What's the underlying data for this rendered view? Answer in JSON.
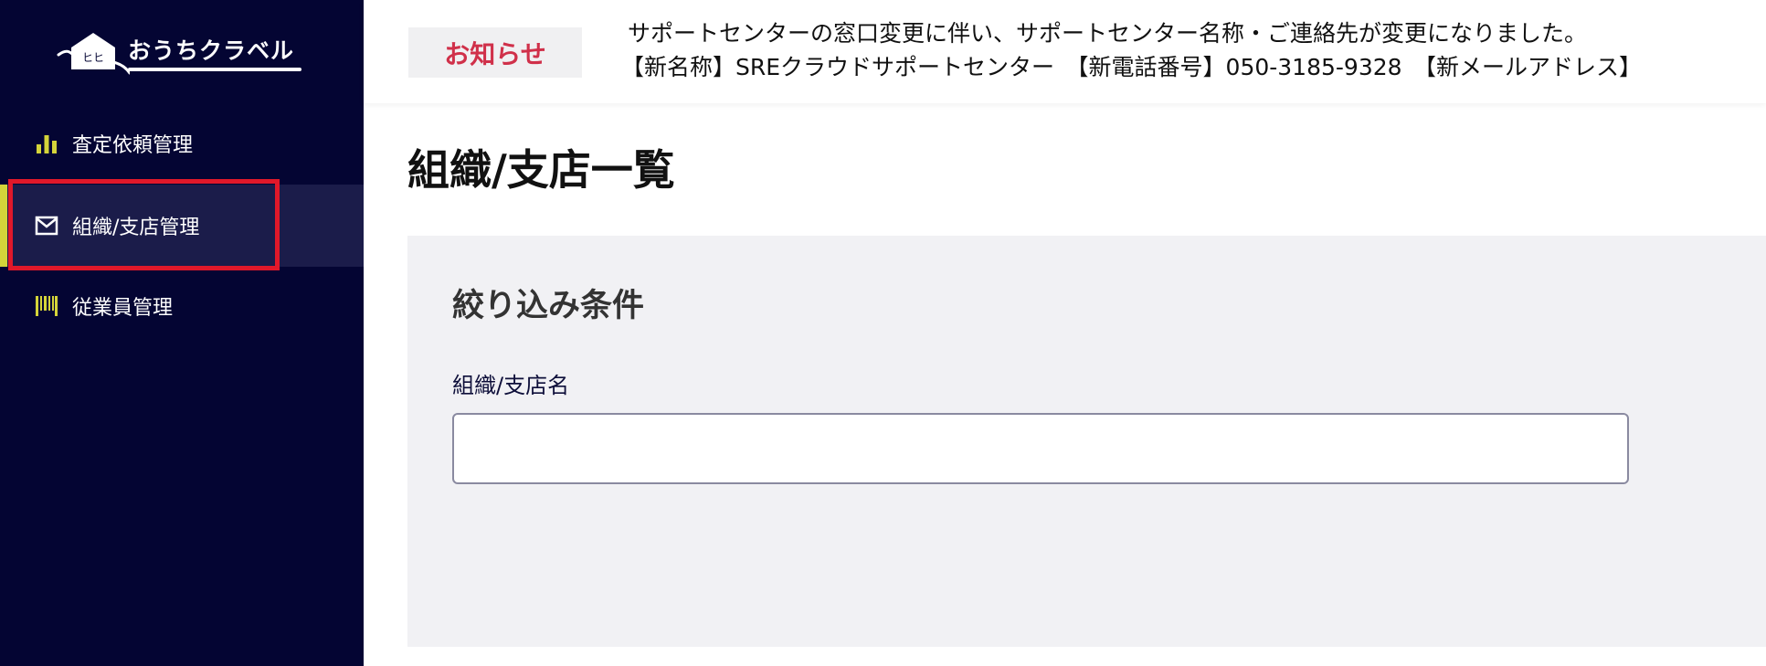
{
  "brand": {
    "logo_text": "おうちクラベル",
    "mascot_face": "ヒヒ"
  },
  "sidebar": {
    "items": [
      {
        "label": "査定依頼管理",
        "icon": "bar-chart-icon",
        "active": false
      },
      {
        "label": "組織/支店管理",
        "icon": "mail-icon",
        "active": true
      },
      {
        "label": "従業員管理",
        "icon": "barcode-icon",
        "active": false
      }
    ]
  },
  "notice": {
    "badge": "お知らせ",
    "line1": "サポートセンターの窓口変更に伴い、サポートセンター名称・ご連絡先が変更になりました。",
    "line2": "【新名称】SREクラウドサポートセンター　【新電話番号】050-3185-9328　【新メールアドレス】"
  },
  "main": {
    "page_title": "組織/支店一覧",
    "filter": {
      "title": "絞り込み条件",
      "org_name_label": "組織/支店名",
      "org_name_value": "",
      "org_name_placeholder": ""
    }
  },
  "colors": {
    "sidebar_bg": "#040533",
    "sidebar_active_bg": "#1b1c4a",
    "accent_yellow": "#d4d43a",
    "highlight_red": "#e0182a",
    "notice_badge_text": "#d0304a",
    "panel_bg": "#f1f1f4"
  }
}
